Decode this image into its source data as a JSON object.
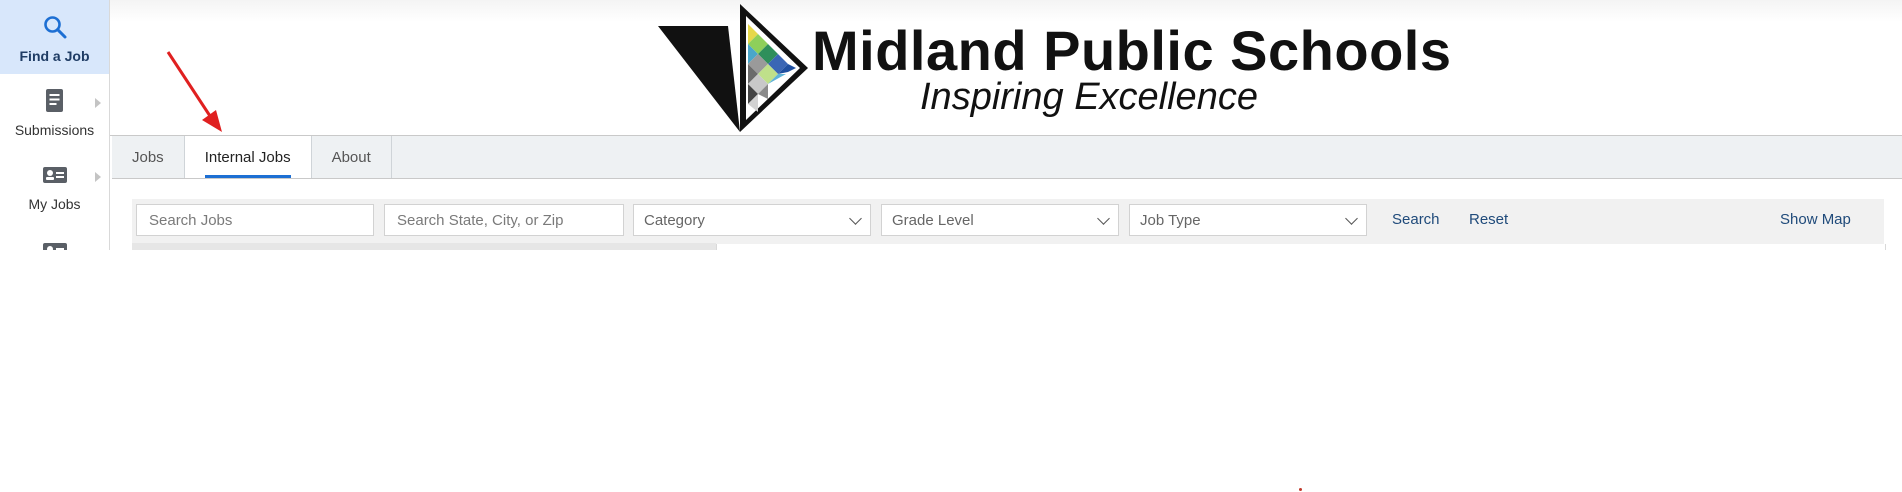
{
  "sidebar": {
    "items": [
      {
        "label": "Find a Job",
        "icon": "search-icon",
        "active": true
      },
      {
        "label": "Submissions",
        "icon": "document-icon",
        "active": false
      },
      {
        "label": "My Jobs",
        "icon": "id-card-icon",
        "active": false
      },
      {
        "label": "",
        "icon": "id-card-icon",
        "active": false
      }
    ]
  },
  "header": {
    "title": "Midland Public Schools",
    "tagline": "Inspiring Excellence"
  },
  "tabs": [
    {
      "label": "Jobs",
      "active": false
    },
    {
      "label": "Internal Jobs",
      "active": true
    },
    {
      "label": "About",
      "active": false
    }
  ],
  "search": {
    "jobs_placeholder": "Search Jobs",
    "location_placeholder": "Search State, City, or Zip",
    "category": "Category",
    "grade_level": "Grade Level",
    "job_type": "Job Type",
    "search_label": "Search",
    "reset_label": "Reset",
    "map_label": "Show Map"
  },
  "colors": {
    "accent": "#1d6fd3",
    "active_bg": "#d8e7fb",
    "annotation": "#e02020"
  }
}
